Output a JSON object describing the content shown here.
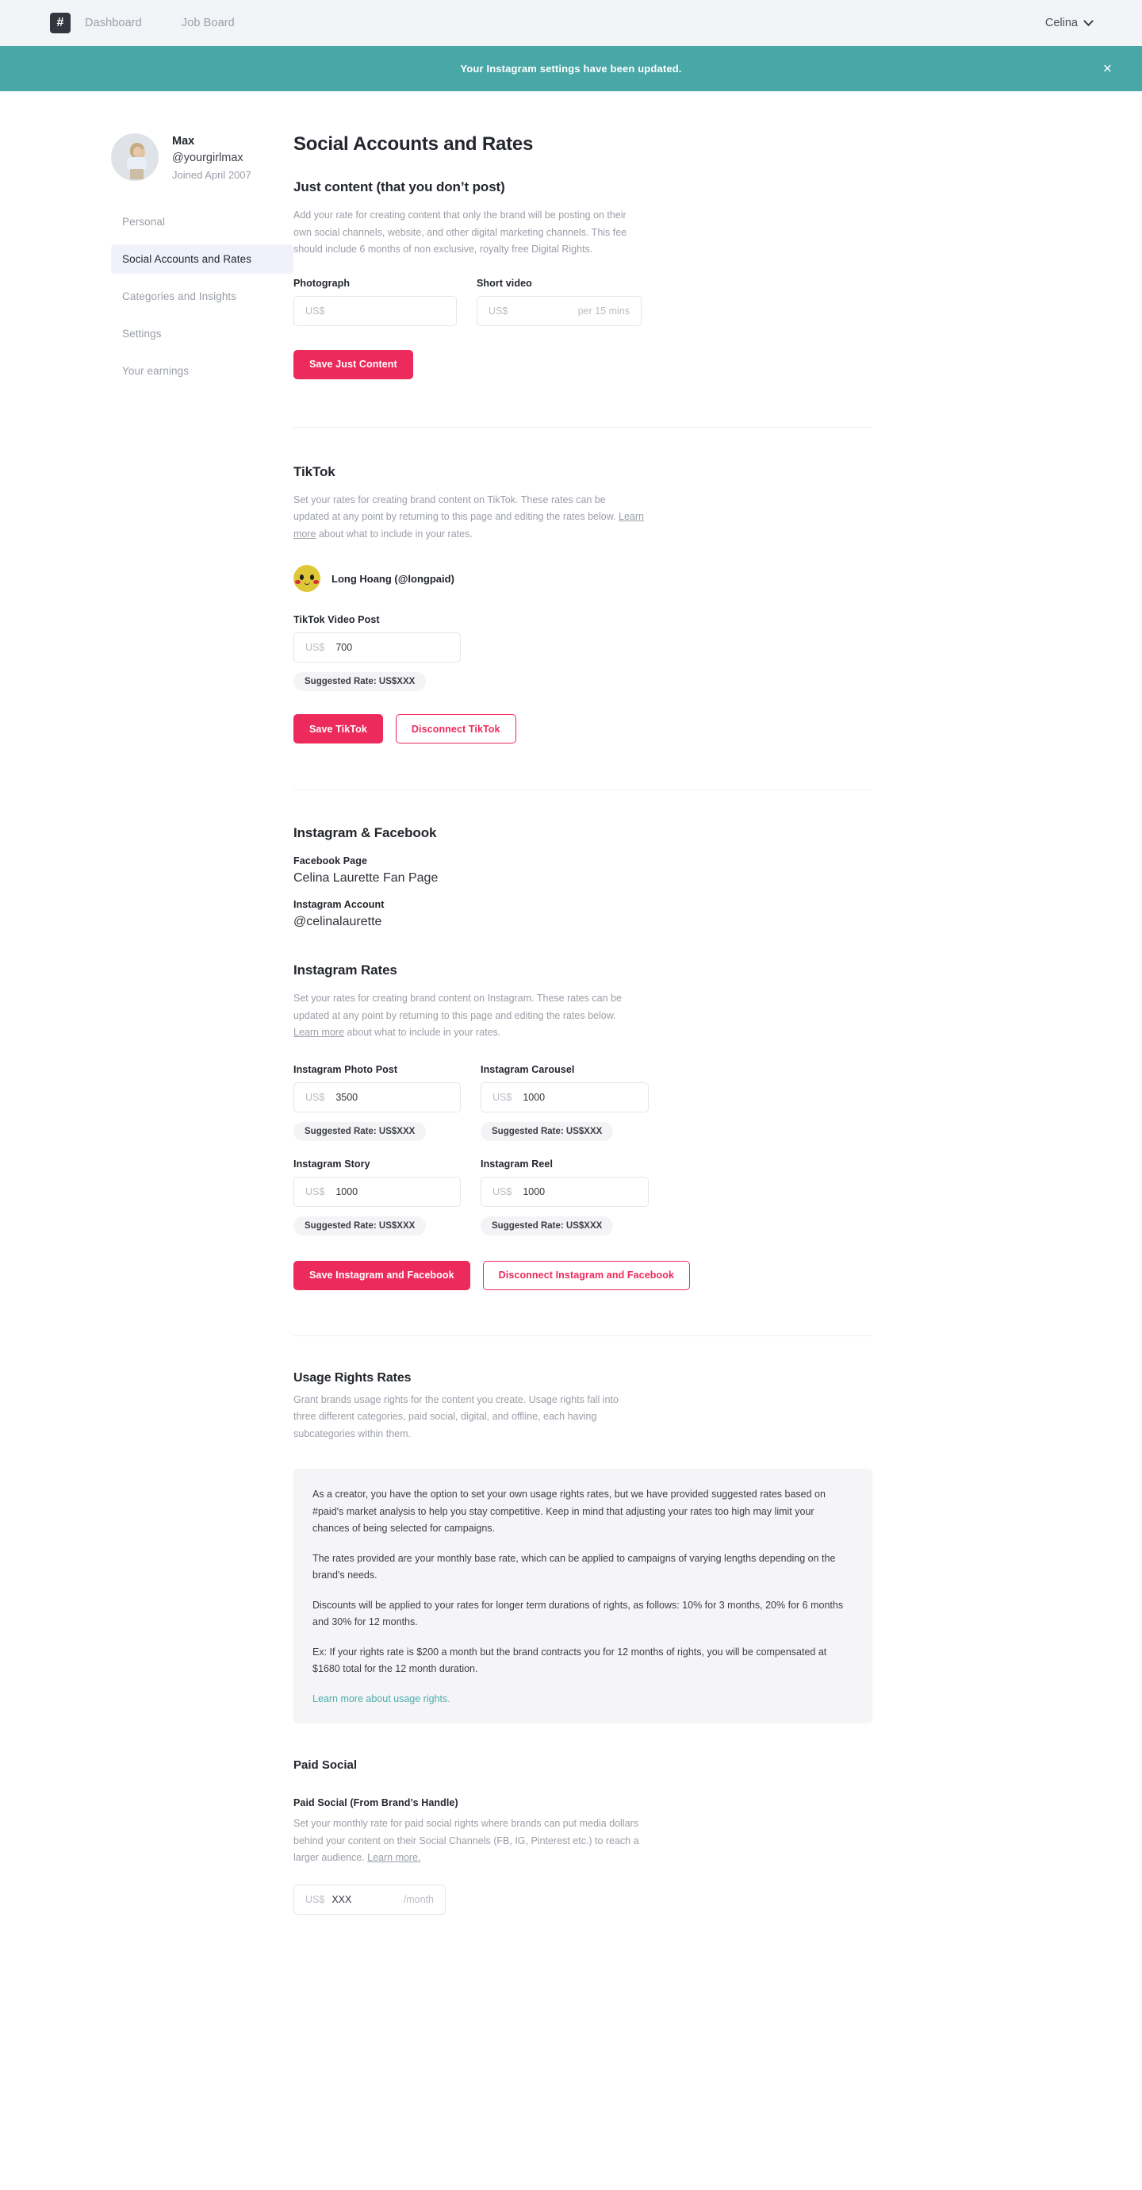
{
  "topnav": {
    "logo": "#",
    "links": [
      {
        "label": "Dashboard"
      },
      {
        "label": "Job Board"
      }
    ],
    "user": "Celina"
  },
  "flash": {
    "message": "Your Instagram settings have been updated.",
    "close": "×",
    "color": "#49a7a8"
  },
  "profile": {
    "name": "Max",
    "handle": "@yourgirlmax",
    "joined": "Joined April 2007"
  },
  "sidebar": {
    "items": [
      {
        "label": "Personal",
        "active": false
      },
      {
        "label": "Social Accounts and Rates",
        "active": true
      },
      {
        "label": "Categories and Insights",
        "active": false
      },
      {
        "label": "Settings",
        "active": false
      },
      {
        "label": "Your earnings",
        "active": false
      }
    ]
  },
  "page": {
    "title": "Social Accounts and Rates"
  },
  "just_content": {
    "title": "Just content (that you don’t post)",
    "description": "Add your rate for creating content that only the brand will be posting on their own social channels, website, and other digital marketing channels. This fee should include 6 months of non exclusive, royalty free Digital Rights.",
    "photograph": {
      "label": "Photograph",
      "currency": "US$",
      "value": "",
      "placeholder": "US$",
      "suffix": ""
    },
    "short_video": {
      "label": "Short video",
      "currency": "US$",
      "value": "",
      "placeholder": "US$",
      "suffix": "per 15 mins"
    },
    "save_label": "Save Just Content"
  },
  "tiktok": {
    "title": "TikTok",
    "description_before": "Set your rates for creating brand content on TikTok. These rates can be updated at any point by returning to this page and editing the rates below. ",
    "learn_more": "Learn more",
    "description_after": " about what to include in your rates.",
    "account": "Long Hoang (@longpaid)",
    "video_post": {
      "label": "TikTok Video Post",
      "currency": "US$",
      "value": "700",
      "suggested": "Suggested Rate: US$XXX"
    },
    "save_label": "Save TikTok",
    "disconnect_label": "Disconnect TikTok"
  },
  "instagram_facebook": {
    "title": "Instagram & Facebook",
    "facebook_page_label": "Facebook Page",
    "facebook_page_value": "Celina Laurette Fan Page",
    "instagram_account_label": "Instagram Account",
    "instagram_account_value": "@celinalaurette"
  },
  "instagram_rates": {
    "title": "Instagram Rates",
    "description_before": "Set your rates for creating brand content on Instagram. These rates can be updated at any point by returning to this page and editing the rates below. ",
    "learn_more": "Learn more",
    "description_after": " about what to include in your rates.",
    "fields": [
      {
        "label": "Instagram Photo Post",
        "currency": "US$",
        "value": "3500",
        "suggested": "Suggested Rate: US$XXX"
      },
      {
        "label": "Instagram Carousel",
        "currency": "US$",
        "value": "1000",
        "suggested": "Suggested Rate: US$XXX"
      },
      {
        "label": "Instagram Story",
        "currency": "US$",
        "value": "1000",
        "suggested": "Suggested Rate: US$XXX"
      },
      {
        "label": "Instagram Reel",
        "currency": "US$",
        "value": "1000",
        "suggested": "Suggested Rate: US$XXX"
      }
    ],
    "save_label": "Save Instagram and Facebook",
    "disconnect_label": "Disconnect Instagram and Facebook"
  },
  "usage_rights": {
    "title": "Usage Rights Rates",
    "description": "Grant brands usage rights for the content you create. Usage rights fall into three different categories, paid social, digital, and offline, each having subcategories within them.",
    "panel": {
      "p1": "As a creator, you have the option to set your own usage rights rates, but we have provided suggested rates based on #paid's market analysis to help you stay competitive. Keep in mind that adjusting your rates too high may limit your chances of being selected for campaigns.",
      "p2": "The rates provided are your monthly base rate, which can be applied to campaigns of varying lengths depending on the brand's needs.",
      "p3": "Discounts will be applied to your rates for longer term durations of rights, as follows: 10% for 3 months, 20% for 6 months and 30% for 12 months.",
      "p4": "Ex: If your rights rate is $200 a month but the brand contracts you for 12 months of rights, you will be compensated at $1680 total for the 12 month duration.",
      "link": "Learn more about usage rights."
    }
  },
  "paid_social": {
    "title": "Paid Social",
    "block_title": "Paid Social (From Brand’s Handle)",
    "description_before": "Set your monthly rate for paid social rights where brands can put media dollars behind your content on their Social Channels (FB, IG, Pinterest etc.) to reach a larger audience. ",
    "learn_more": "Learn more.",
    "input": {
      "currency": "US$",
      "value": "XXX",
      "suffix": "/month"
    }
  },
  "colors": {
    "accent": "#ed2a5c",
    "teal": "#49a7a8",
    "active_nav_bg": "#f1f1fb"
  }
}
